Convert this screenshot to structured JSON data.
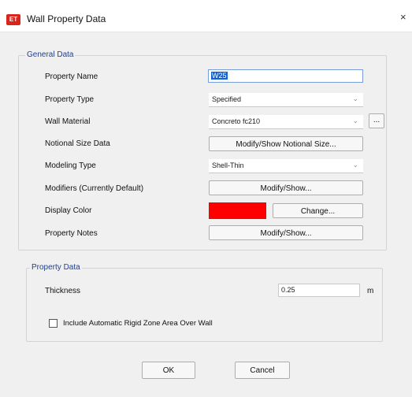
{
  "window": {
    "title": "Wall Property Data",
    "app_icon_text": "ET",
    "close_glyph": "×"
  },
  "general": {
    "group_label": "General Data",
    "property_name": {
      "label": "Property Name",
      "value": "W25"
    },
    "property_type": {
      "label": "Property Type",
      "value": "Specified"
    },
    "wall_material": {
      "label": "Wall Material",
      "value": "Concreto fc210",
      "browse_label": "..."
    },
    "notional_size": {
      "label": "Notional Size Data",
      "button": "Modify/Show Notional Size..."
    },
    "modeling_type": {
      "label": "Modeling Type",
      "value": "Shell-Thin"
    },
    "modifiers": {
      "label": "Modifiers (Currently Default)",
      "button": "Modify/Show..."
    },
    "display_color": {
      "label": "Display Color",
      "button": "Change...",
      "color": "#ff0000"
    },
    "property_notes": {
      "label": "Property Notes",
      "button": "Modify/Show..."
    }
  },
  "property_data": {
    "group_label": "Property Data",
    "thickness": {
      "label": "Thickness",
      "value": "0.25",
      "unit": "m"
    },
    "rigid_zone": {
      "label": "Include Automatic Rigid Zone Area Over Wall",
      "checked": false
    }
  },
  "buttons": {
    "ok": "OK",
    "cancel": "Cancel"
  },
  "icons": {
    "dropdown": "chevron-down-icon"
  }
}
